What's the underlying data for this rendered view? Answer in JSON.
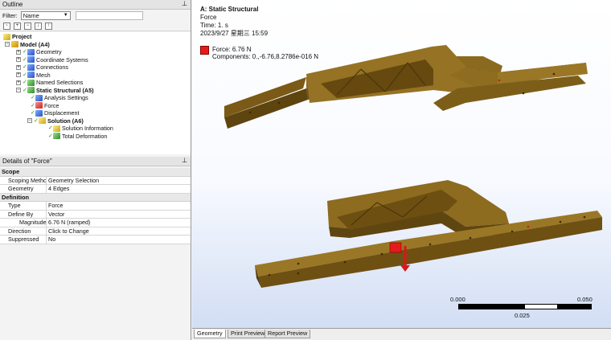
{
  "outline": {
    "title": "Outline",
    "filter_label": "Filter:",
    "filter_value": "Name",
    "tree": [
      {
        "label": "Project",
        "bold": true
      },
      {
        "label": "Model (A4)",
        "bold": true
      },
      {
        "label": "Geometry"
      },
      {
        "label": "Coordinate Systems"
      },
      {
        "label": "Connections"
      },
      {
        "label": "Mesh"
      },
      {
        "label": "Named Selections"
      },
      {
        "label": "Static Structural (A5)",
        "bold": true
      },
      {
        "label": "Analysis Settings"
      },
      {
        "label": "Force"
      },
      {
        "label": "Displacement"
      },
      {
        "label": "Solution (A6)",
        "bold": true
      },
      {
        "label": "Solution Information"
      },
      {
        "label": "Total Deformation"
      }
    ]
  },
  "details": {
    "title": "Details of \"Force\"",
    "sections": {
      "scope": "Scope",
      "definition": "Definition"
    },
    "rows": {
      "scoping_method": {
        "key": "Scoping Method",
        "value": "Geometry Selection"
      },
      "geometry": {
        "key": "Geometry",
        "value": "4 Edges"
      },
      "type": {
        "key": "Type",
        "value": "Force"
      },
      "define_by": {
        "key": "Define By",
        "value": "Vector"
      },
      "magnitude": {
        "key": "Magnitude",
        "value": "6.76 N  (ramped)"
      },
      "direction": {
        "key": "Direction",
        "value": "Click to Change"
      },
      "suppressed": {
        "key": "Suppressed",
        "value": "No"
      }
    }
  },
  "viewport": {
    "title": "A: Static Structural",
    "subtitle": "Force",
    "time": "Time: 1. s",
    "date": "2023/9/27 星期三 15:59",
    "legend_force": "Force: 6.76 N",
    "legend_components": "Components: 0.,-6.76,8.2786e-016 N",
    "scale": {
      "left": "0.000",
      "right": "0.050",
      "mid": "0.025"
    }
  },
  "tabs": [
    "Geometry",
    "Print Preview",
    "Report Preview"
  ],
  "colors": {
    "part": "#8a6a1e",
    "force": "#e51b1b"
  }
}
